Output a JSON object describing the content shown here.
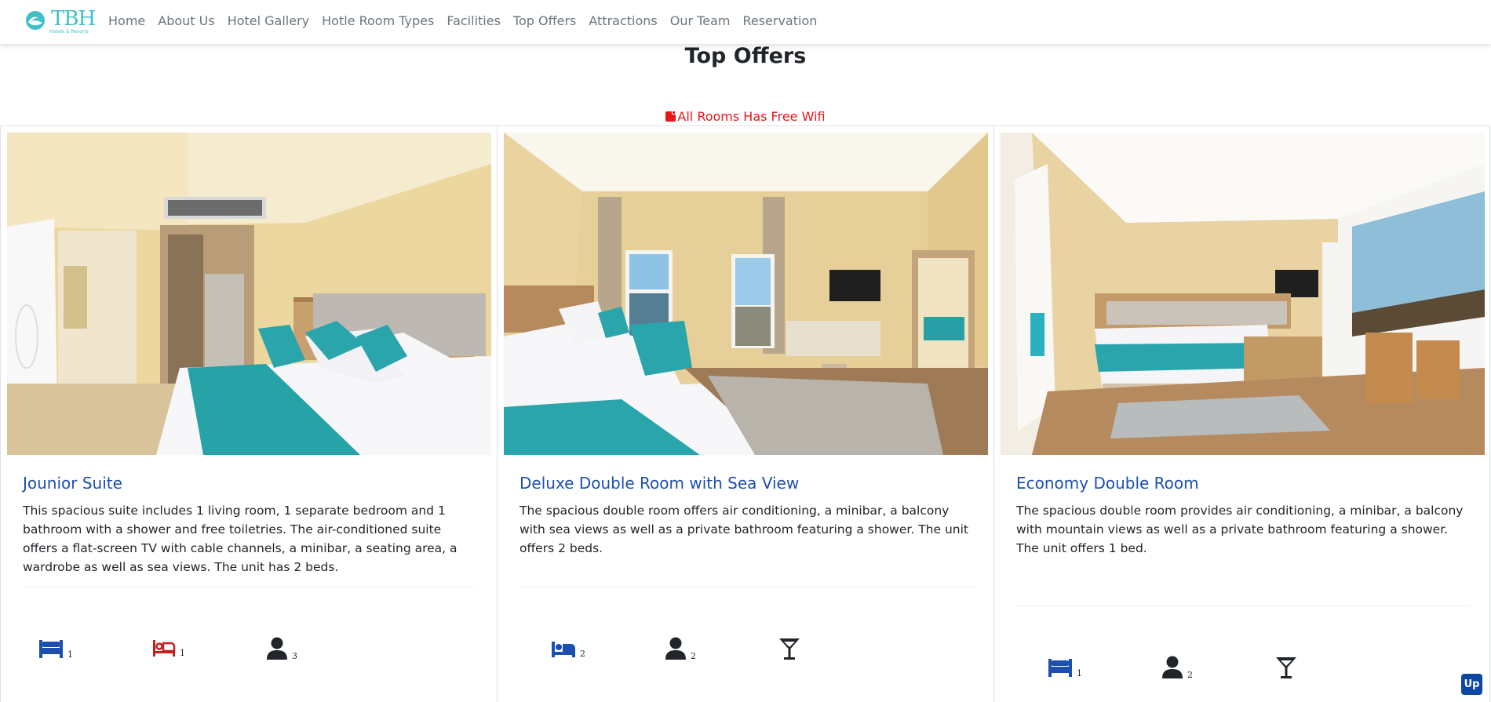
{
  "brand": {
    "name": "TBH",
    "tagline": "Hotels & Resorts",
    "color": "#3fc0c6"
  },
  "nav": {
    "items": [
      "Home",
      "About Us",
      "Hotel Gallery",
      "Hotle Room Types",
      "Facilities",
      "Top Offers",
      "Attractions",
      "Our Team",
      "Reservation"
    ]
  },
  "section": {
    "title": "Top Offers",
    "notice": "All Rooms Has Free Wifi"
  },
  "colors": {
    "accent": "#1c4fb0",
    "notice": "#e8161b",
    "up_button": "#0d47a1"
  },
  "cards": [
    {
      "title": "Jounior Suite",
      "description": "This spacious suite includes 1 living room, 1 separate bedroom and 1 bathroom with a shower and free toiletries. The air-conditioned suite offers a flat-screen TV with cable channels, a minibar, a seating area, a wardrobe as well as sea views. The unit has 2 beds.",
      "image": "junior-suite-room-photo",
      "amenities": [
        {
          "icon": "double-bed-icon",
          "count": "1",
          "color": "#1c4fb0"
        },
        {
          "icon": "single-bed-icon",
          "count": "1",
          "color": "#c41e1e"
        },
        {
          "icon": "person-icon",
          "count": "3",
          "color": "#212529"
        }
      ]
    },
    {
      "title": "Deluxe Double Room with Sea View",
      "description": "The spacious double room offers air conditioning, a minibar, a balcony with sea views as well as a private bathroom featuring a shower. The unit offers 2 beds.",
      "image": "deluxe-double-room-photo",
      "amenities": [
        {
          "icon": "bed-with-person-icon",
          "count": "2",
          "color": "#1c4fb0"
        },
        {
          "icon": "person-icon",
          "count": "2",
          "color": "#212529"
        },
        {
          "icon": "cocktail-glass-icon",
          "count": "",
          "color": "#212529"
        }
      ]
    },
    {
      "title": "Economy Double Room",
      "description": "The spacious double room provides air conditioning, a minibar, a balcony with mountain views as well as a private bathroom featuring a shower. The unit offers 1 bed.",
      "image": "economy-double-room-photo",
      "amenities": [
        {
          "icon": "double-bed-icon",
          "count": "1",
          "color": "#1c4fb0"
        },
        {
          "icon": "person-icon",
          "count": "2",
          "color": "#212529"
        },
        {
          "icon": "cocktail-glass-icon",
          "count": "",
          "color": "#212529"
        }
      ]
    }
  ],
  "up_button": {
    "label": "Up"
  }
}
